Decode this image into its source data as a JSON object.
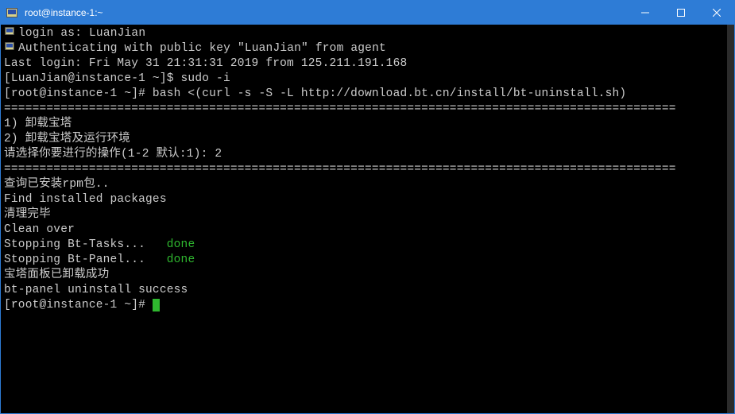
{
  "window": {
    "title": "root@instance-1:~"
  },
  "terminal": {
    "lines": [
      {
        "icon": true,
        "text": "login as: LuanJian"
      },
      {
        "icon": true,
        "text": "Authenticating with public key \"LuanJian\" from agent"
      },
      {
        "text": "Last login: Fri May 31 21:31:31 2019 from 125.211.191.168"
      },
      {
        "text": "[LuanJian@instance-1 ~]$ sudo -i"
      },
      {
        "text": "[root@instance-1 ~]# bash <(curl -s -S -L http://download.bt.cn/install/bt-uninstall.sh)"
      },
      {
        "text": "==============================================================================================="
      },
      {
        "text": "1) 卸载宝塔"
      },
      {
        "text": "2) 卸载宝塔及运行环境"
      },
      {
        "text": "请选择你要进行的操作(1-2 默认:1): 2"
      },
      {
        "text": "==============================================================================================="
      },
      {
        "text": "查询已安装rpm包.."
      },
      {
        "text": "Find installed packages"
      },
      {
        "text": "清理完毕"
      },
      {
        "text": "Clean over"
      },
      {
        "prefix": "Stopping Bt-Tasks...   ",
        "status": "done"
      },
      {
        "prefix": "Stopping Bt-Panel...   ",
        "status": "done"
      },
      {
        "text": "宝塔面板已卸载成功"
      },
      {
        "text": "bt-panel uninstall success"
      },
      {
        "prompt": "[root@instance-1 ~]# ",
        "cursor": true
      }
    ]
  }
}
